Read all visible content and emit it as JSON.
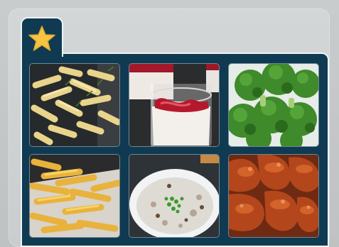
{
  "favorites": {
    "tab_icon": "star-icon",
    "items": [
      {
        "icon": "pasta-image"
      },
      {
        "icon": "dessert-cup-image"
      },
      {
        "icon": "broccoli-image"
      },
      {
        "icon": "french-fries-image"
      },
      {
        "icon": "soup-bowl-image"
      },
      {
        "icon": "glazed-chicken-image"
      }
    ]
  },
  "colors": {
    "panel": "#0f3a52",
    "border": "#eef2f4",
    "star": "#f6c443",
    "background": "#c9cccd"
  }
}
